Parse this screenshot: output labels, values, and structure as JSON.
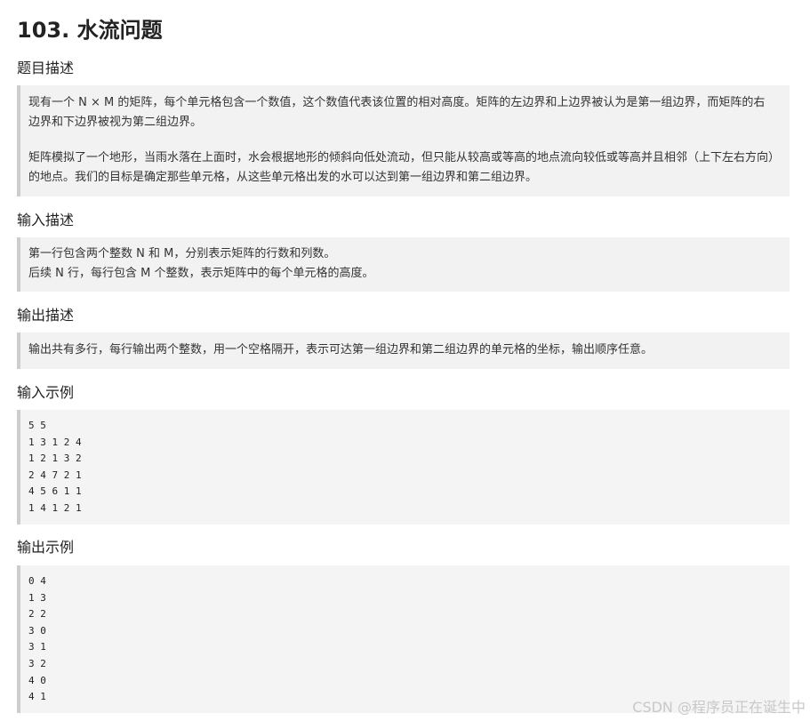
{
  "title": "103. 水流问题",
  "sections": {
    "problem": {
      "heading": "题目描述",
      "paragraphs": [
        "现有一个 N × M 的矩阵，每个单元格包含一个数值，这个数值代表该位置的相对高度。矩阵的左边界和上边界被认为是第一组边界，而矩阵的右边界和下边界被视为第二组边界。",
        "矩阵模拟了一个地形，当雨水落在上面时，水会根据地形的倾斜向低处流动，但只能从较高或等高的地点流向较低或等高并且相邻（上下左右方向）的地点。我们的目标是确定那些单元格，从这些单元格出发的水可以达到第一组边界和第二组边界。"
      ]
    },
    "input": {
      "heading": "输入描述",
      "lines": [
        "第一行包含两个整数 N 和 M，分别表示矩阵的行数和列数。",
        "后续 N 行，每行包含 M 个整数，表示矩阵中的每个单元格的高度。"
      ]
    },
    "output": {
      "heading": "输出描述",
      "lines": [
        "输出共有多行，每行输出两个整数，用一个空格隔开，表示可达第一组边界和第二组边界的单元格的坐标，输出顺序任意。"
      ]
    },
    "input_example": {
      "heading": "输入示例",
      "lines": [
        "5 5",
        "1 3 1 2 4",
        "1 2 1 3 2",
        "2 4 7 2 1",
        "4 5 6 1 1",
        "1 4 1 2 1"
      ]
    },
    "output_example": {
      "heading": "输出示例",
      "lines": [
        "0 4",
        "1 3",
        "2 2",
        "3 0",
        "3 1",
        "3 2",
        "4 0",
        "4 1"
      ]
    }
  },
  "watermark": "CSDN @程序员正在诞生中"
}
